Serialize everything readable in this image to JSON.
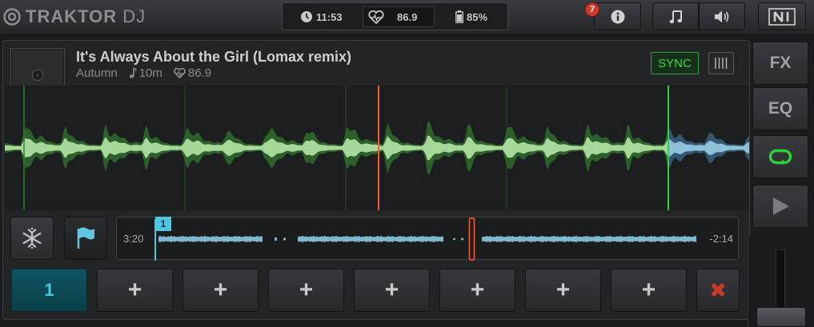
{
  "app": {
    "logo_text": "TRAKTOR",
    "logo_suffix": "DJ"
  },
  "status": {
    "time": "11:53",
    "bpm": "86.9",
    "battery": "85%"
  },
  "toolbar": {
    "notification_count": "7"
  },
  "track": {
    "title": "It's Always About the Girl (Lomax remix)",
    "artist": "Autumn",
    "key": "10m",
    "bpm": "86.9"
  },
  "deck": {
    "sync_label": "SYNC",
    "sync_color": "#3fd44d"
  },
  "overview": {
    "elapsed": "3:20",
    "remaining": "-2:14",
    "cue_marker": "1",
    "position_fraction": 0.57
  },
  "cues": [
    {
      "label": "1",
      "state": "active"
    },
    {
      "label": "+",
      "state": "empty"
    },
    {
      "label": "+",
      "state": "empty"
    },
    {
      "label": "+",
      "state": "empty"
    },
    {
      "label": "+",
      "state": "empty"
    },
    {
      "label": "+",
      "state": "empty"
    },
    {
      "label": "+",
      "state": "empty"
    },
    {
      "label": "+",
      "state": "empty"
    }
  ],
  "cue_delete_label": "✖",
  "side_panel": {
    "fx_label": "FX",
    "eq_label": "EQ",
    "loop_color": "#2fd13c"
  },
  "icons": [
    "clock-icon",
    "heartbeat-icon",
    "battery-icon",
    "info-icon",
    "music-note-icon",
    "speaker-icon",
    "ni-logo-icon",
    "vinyl-icon",
    "snowflake-icon",
    "flag-icon",
    "loop-icon",
    "play-icon"
  ]
}
